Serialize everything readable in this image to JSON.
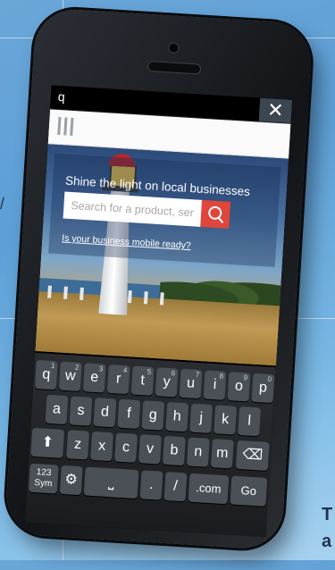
{
  "browser": {
    "url_value": "q",
    "close_label": "✕"
  },
  "site": {
    "tagline": "Shine the light on local businesses",
    "search_placeholder": "Search for a product, service…",
    "mobile_link": "Is your business mobile ready?"
  },
  "keyboard": {
    "row1": [
      {
        "label": "q",
        "num": "1"
      },
      {
        "label": "w",
        "num": "2"
      },
      {
        "label": "e",
        "num": "3"
      },
      {
        "label": "r",
        "num": "4"
      },
      {
        "label": "t",
        "num": "5"
      },
      {
        "label": "y",
        "num": "6"
      },
      {
        "label": "u",
        "num": "7"
      },
      {
        "label": "i",
        "num": "8"
      },
      {
        "label": "o",
        "num": "9"
      },
      {
        "label": "p",
        "num": "0"
      }
    ],
    "row2": [
      "a",
      "s",
      "d",
      "f",
      "g",
      "h",
      "j",
      "k",
      "l"
    ],
    "row3": [
      "z",
      "x",
      "c",
      "v",
      "b",
      "n",
      "m"
    ],
    "sym_label": "123 Sym",
    "period_label": ".",
    "slash_label": "/",
    "dotcom_label": ".com",
    "go_label": "Go"
  }
}
